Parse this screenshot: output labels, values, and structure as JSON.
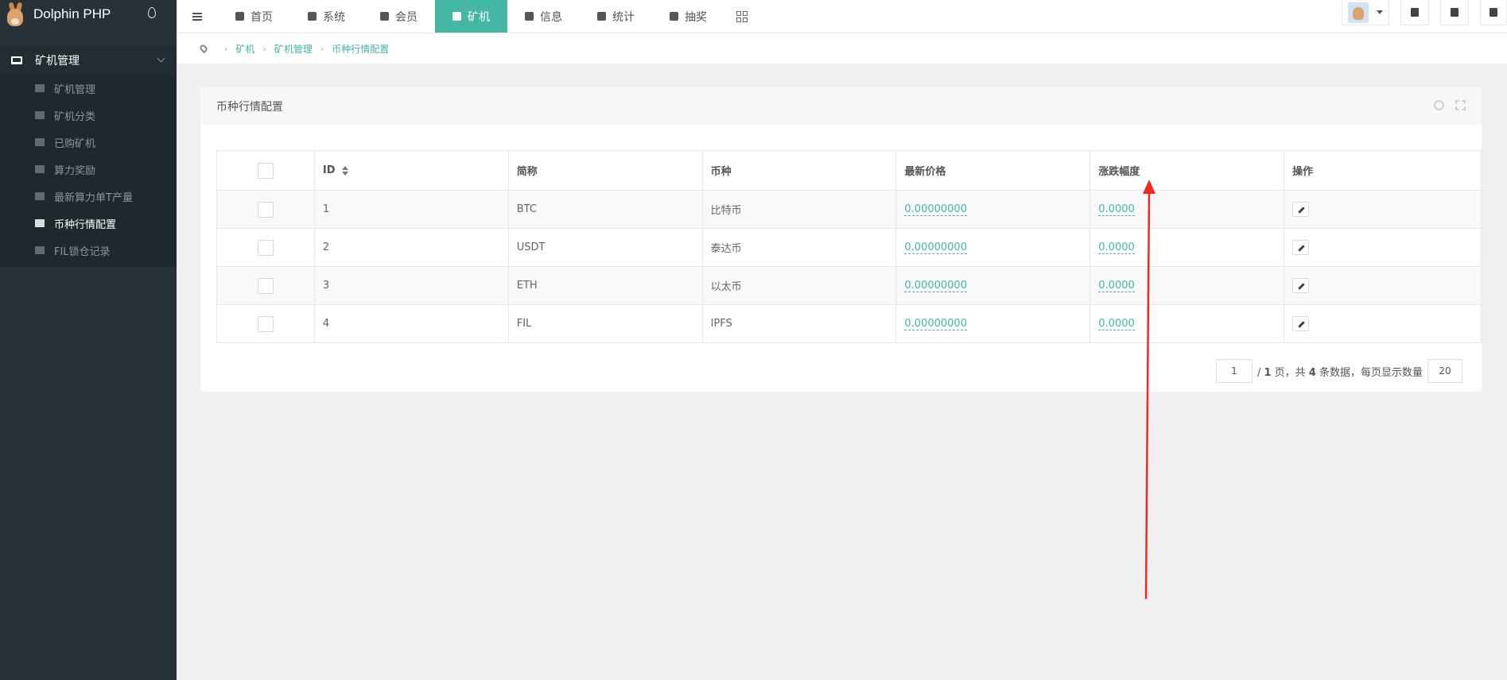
{
  "brand": {
    "name": "Dolphin PHP"
  },
  "sidebar": {
    "group_label": "矿机管理",
    "items": [
      {
        "label": "矿机管理",
        "active": false
      },
      {
        "label": "矿机分类",
        "active": false
      },
      {
        "label": "已购矿机",
        "active": false
      },
      {
        "label": "算力奖励",
        "active": false
      },
      {
        "label": "最新算力单T产量",
        "active": false
      },
      {
        "label": "币种行情配置",
        "active": true
      },
      {
        "label": "FIL锁仓记录",
        "active": false
      }
    ]
  },
  "topnav": {
    "items": [
      {
        "label": "首页",
        "icon": "home-icon"
      },
      {
        "label": "系统",
        "icon": "gear-icon"
      },
      {
        "label": "会员",
        "icon": "user-icon"
      },
      {
        "label": "矿机",
        "icon": "windows-icon",
        "active": true
      },
      {
        "label": "信息",
        "icon": "yelp-icon"
      },
      {
        "label": "统计",
        "icon": "pie-chart-icon"
      },
      {
        "label": "抽奖",
        "icon": "stamp-icon"
      }
    ]
  },
  "breadcrumb": [
    "矿机",
    "矿机管理",
    "币种行情配置"
  ],
  "panel": {
    "title": "币种行情配置"
  },
  "table": {
    "headers": [
      "ID",
      "简称",
      "币种",
      "最新价格",
      "涨跌幅度",
      "操作"
    ],
    "rows": [
      {
        "id": "1",
        "short": "BTC",
        "coin": "比特币",
        "price": "0.00000000",
        "change": "0.0000"
      },
      {
        "id": "2",
        "short": "USDT",
        "coin": "泰达币",
        "price": "0.00000000",
        "change": "0.0000"
      },
      {
        "id": "3",
        "short": "ETH",
        "coin": "以太币",
        "price": "0.00000000",
        "change": "0.0000"
      },
      {
        "id": "4",
        "short": "FIL",
        "coin": "IPFS",
        "price": "0.00000000",
        "change": "0.0000"
      }
    ]
  },
  "pager": {
    "current_page": "1",
    "total_pages": "1",
    "page_suffix": "页，共",
    "total_count": "4",
    "count_suffix": "条数据，每页显示数量",
    "page_size": "20"
  },
  "colors": {
    "accent": "#44b6a4",
    "sidebar_bg": "#263237",
    "annotation": "#f02a1f"
  }
}
